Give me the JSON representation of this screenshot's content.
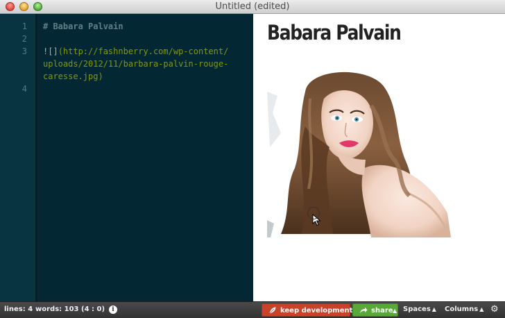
{
  "window": {
    "title": "Untitled (edited)"
  },
  "editor": {
    "line_numbers": [
      "1",
      "2",
      "3",
      "4"
    ],
    "lines": {
      "line1": "# Babara Palvain",
      "line3_bang": "![]",
      "line3_url_a": "(http://fashnberry.com/wp-content/",
      "line3_url_b": "uploads/2012/11/barbara-palvin-rouge-",
      "line3_url_c": "caresse.jpg)"
    }
  },
  "preview": {
    "heading": "Babara Palvain",
    "image_alt": "portrait photo"
  },
  "statusbar": {
    "lines": "lines: 4",
    "words": "words: 103",
    "cursor": "(4 : 0)",
    "info_glyph": "i",
    "keep_label": "keep development",
    "share_label": "share",
    "spaces_label": "Spaces",
    "columns_label": "Columns",
    "gear_glyph": "⚙"
  },
  "colors": {
    "editor_bg": "#032833",
    "gutter_bg": "#073440",
    "url": "#859900",
    "keep_button": "#c9432b",
    "share_button": "#58a83a",
    "statusbar": "#3a3a3a"
  }
}
